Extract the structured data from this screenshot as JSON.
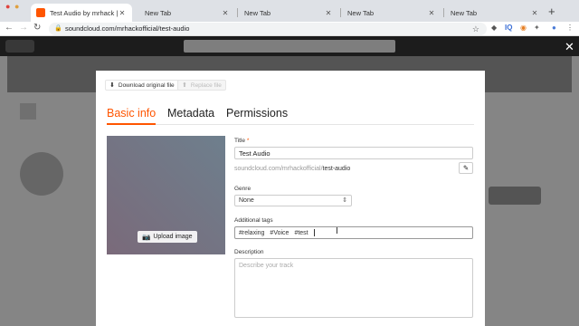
{
  "browser": {
    "tabs": [
      {
        "title": "Test Audio by mrhack | mrha",
        "active": true
      },
      {
        "title": "New Tab",
        "active": false
      },
      {
        "title": "New Tab",
        "active": false
      },
      {
        "title": "New Tab",
        "active": false
      },
      {
        "title": "New Tab",
        "active": false
      }
    ],
    "url": "soundcloud.com/mrhackofficial/test-audio"
  },
  "modal": {
    "download_label": "Download original file",
    "replace_label": "Replace file",
    "tabs": [
      "Basic info",
      "Metadata",
      "Permissions"
    ],
    "active_tab": "Basic info",
    "upload_image_label": "Upload image",
    "title_label": "Title",
    "title_required_mark": "*",
    "title_value": "Test Audio",
    "permalink_base": "soundcloud.com/mrhackofficial/",
    "permalink_slug": "test-audio",
    "genre_label": "Genre",
    "genre_value": "None",
    "tags_label": "Additional tags",
    "tags": [
      "#relaxing",
      "#Voice",
      "#test"
    ],
    "description_label": "Description",
    "description_placeholder": "Describe your track"
  },
  "colors": {
    "accent": "#ff5500"
  }
}
